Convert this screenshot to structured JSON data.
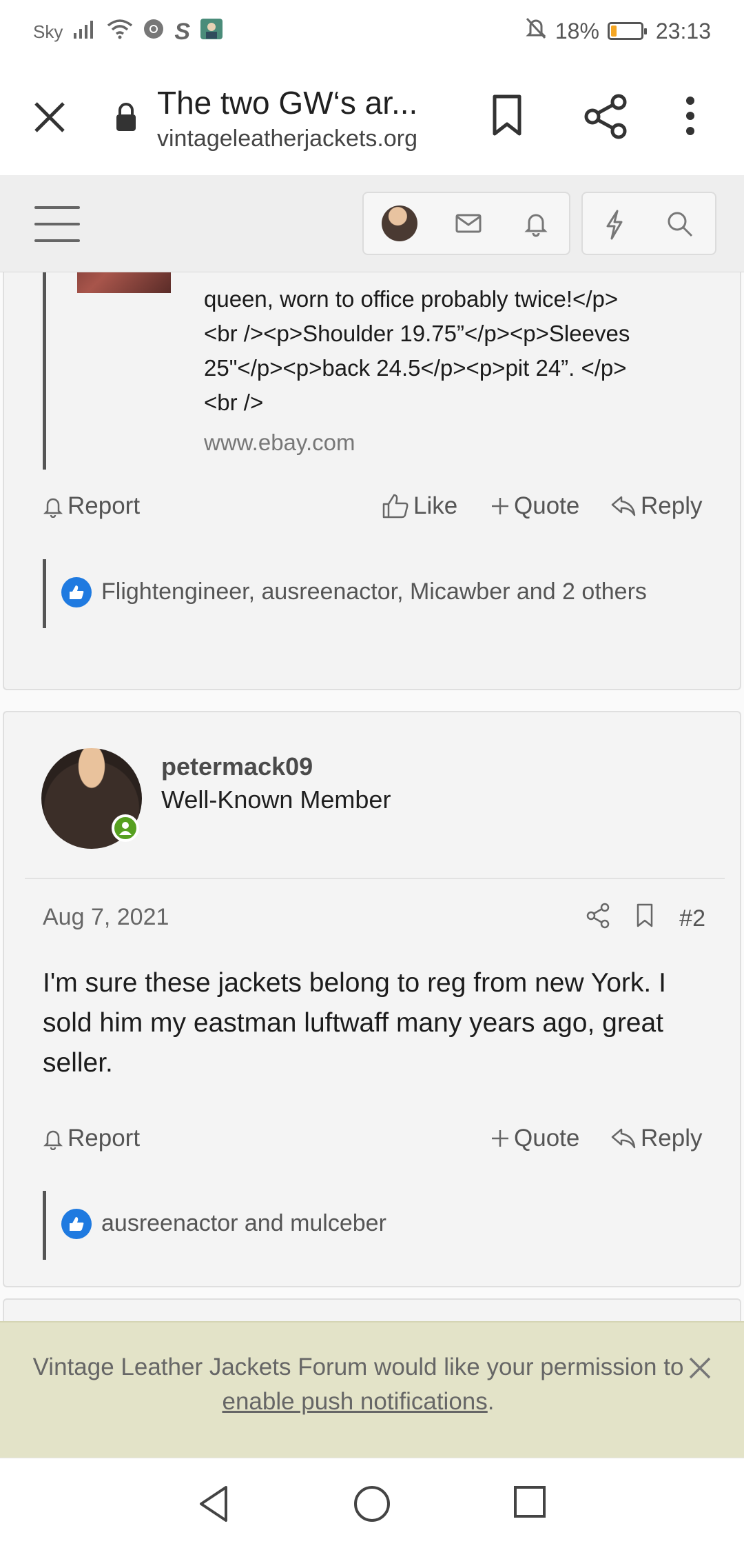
{
  "status_bar": {
    "carrier": "Sky",
    "battery_percent": "18%",
    "battery_level": 0.18,
    "time": "23:13",
    "icons": [
      "signal-icon",
      "wifi-icon",
      "chrome-icon",
      "s-app-icon",
      "app-icon",
      "mute-bell-icon"
    ]
  },
  "browser": {
    "title": "The two GW‘s ar...",
    "url": "vintageleatherjackets.org"
  },
  "post1": {
    "quote_lines": [
      "queen, worn to office probably twice!</p>",
      "<br /><p>Shoulder 19.75”</p><p>Sleeves",
      "25\"</p><p>back 24.5</p><p>pit 24”. </p>",
      "<br />"
    ],
    "quote_source": "www.ebay.com",
    "actions": {
      "report": "Report",
      "like": "Like",
      "quote": "Quote",
      "reply": "Reply"
    },
    "reactions": "Flightengineer, ausreenactor, Micawber and 2 others"
  },
  "post2": {
    "username": "petermack09",
    "role": "Well-Known Member",
    "date": "Aug 7, 2021",
    "post_number": "#2",
    "body": "I'm sure these jackets belong to reg from new York. I sold him my eastman luftwaff many years ago, great seller.",
    "actions": {
      "report": "Report",
      "quote": "Quote",
      "reply": "Reply"
    },
    "reactions": "ausreenactor and mulceber"
  },
  "push_notice": {
    "text_before": "Vintage Leather Jackets Forum would like your permission to ",
    "link": "enable push notifications",
    "text_after": "."
  }
}
